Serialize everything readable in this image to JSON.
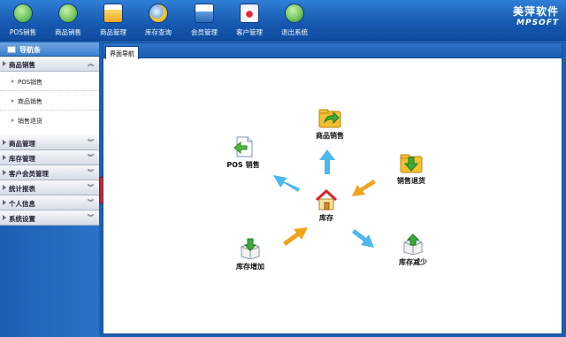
{
  "toolbar": {
    "items": [
      {
        "label": "POS销售",
        "icon": "pos-sale-icon"
      },
      {
        "label": "商品销售",
        "icon": "product-sale-icon"
      },
      {
        "label": "商品管理",
        "icon": "product-manage-icon"
      },
      {
        "label": "库存查询",
        "icon": "stock-search-icon"
      },
      {
        "label": "会员管理",
        "icon": "member-manage-icon"
      },
      {
        "label": "客户管理",
        "icon": "customer-manage-icon"
      },
      {
        "label": "退出系统",
        "icon": "exit-icon"
      }
    ]
  },
  "logo": {
    "line1": "美萍软件",
    "line2": "MPSOFT"
  },
  "sidebar": {
    "title": "导航条",
    "sections": [
      {
        "label": "商品销售"
      },
      {
        "label": "商品管理"
      },
      {
        "label": "库存管理"
      },
      {
        "label": "客户会员管理"
      },
      {
        "label": "统计报表"
      },
      {
        "label": "个人信息"
      },
      {
        "label": "系统设置"
      }
    ],
    "sub_items": [
      {
        "label": "POS销售"
      },
      {
        "label": "商品销售"
      },
      {
        "label": "销售退货"
      }
    ]
  },
  "main": {
    "tab_label": "界面导航",
    "nodes": {
      "product_sale": "商品销售",
      "pos_sale": "POS 销售",
      "sale_return": "销售退货",
      "stock": "库存",
      "stock_add": "库存增加",
      "stock_reduce": "库存减少"
    }
  },
  "colors": {
    "toolbar_bg": "#1659b0",
    "arrow_blue": "#4db8ea",
    "arrow_orange": "#f2a21b",
    "handle": "#cc2222"
  }
}
